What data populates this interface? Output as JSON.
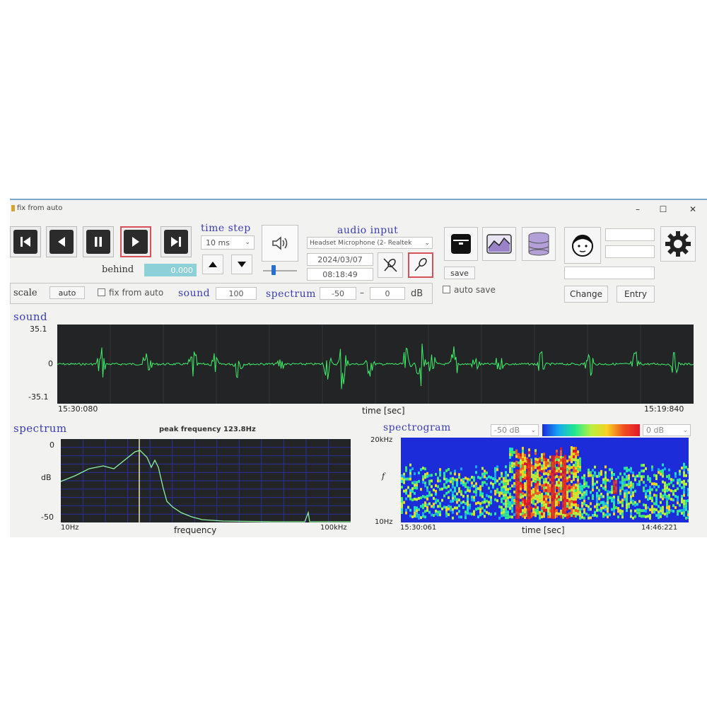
{
  "window": {
    "title": "fix from auto",
    "minimize_icon": "minimize-icon",
    "maximize_icon": "maximize-icon",
    "close_icon": "close-icon"
  },
  "transport": {
    "icons": [
      "skip-to-start-icon",
      "step-back-icon",
      "pause-icon",
      "play-icon",
      "skip-to-end-icon"
    ],
    "selected": "play",
    "behind_label": "behind",
    "behind_value": "0.000"
  },
  "time_step": {
    "label": "time step",
    "value": "10 ms",
    "up_icon": "triangle-up-icon",
    "down_icon": "triangle-down-icon"
  },
  "volume": {
    "icon": "speaker-icon"
  },
  "audio_input": {
    "label": "audio input",
    "device": "Headset Microphone (2- Realtek",
    "date": "2024/03/07",
    "time": "08:18:49",
    "mute_icon": "microphone-muted-icon",
    "mic_icon": "microphone-icon"
  },
  "actions": {
    "save_icon": "archive-box-icon",
    "chart_icon": "chart-icon",
    "database_icon": "database-icon",
    "save_label": "save",
    "auto_save_label": "auto save",
    "user_icon": "user-face-icon",
    "change_label": "Change",
    "entry_label": "Entry",
    "settings_icon": "gear-icon"
  },
  "controls": {
    "scale_label": "scale",
    "scale_button": "auto",
    "fix_from_auto_label": "fix from auto",
    "sound_label": "sound",
    "sound_value": "100",
    "spectrum_label": "spectrum",
    "spectrum_min": "-50",
    "dash": "–",
    "spectrum_max": "0",
    "unit": "dB"
  },
  "sound_panel": {
    "title": "sound",
    "y_max": "35.1",
    "y_zero": "0",
    "y_min": "-35.1",
    "x_start": "15:30:080",
    "x_label": "time [sec]",
    "x_end": "15:19:840",
    "line_color": "#3ef06a"
  },
  "spectrum_panel": {
    "title": "spectrum",
    "peak_text": "peak frequency 123.8Hz",
    "y_top": "0",
    "y_label": "dB",
    "y_bottom": "-50",
    "x_start": "10Hz",
    "x_label": "frequency",
    "x_end": "100kHz",
    "grid_color": "#2a2f9a",
    "line_color": "#8ef0a0",
    "marker_color": "#e8e4b0"
  },
  "spectrogram_panel": {
    "title": "spectrogram",
    "range_min": "-50 dB",
    "range_max": "0 dB",
    "y_top": "20kHz",
    "y_label": "f",
    "y_bottom": "10Hz",
    "x_start": "15:30:061",
    "x_label": "time [sec]",
    "x_end": "14:46:221"
  },
  "colors": {
    "label_blue": "#3c3cb4",
    "behind_bg": "#8ed0d8",
    "selected_border": "#d8505a",
    "plot_bg": "#232426"
  }
}
